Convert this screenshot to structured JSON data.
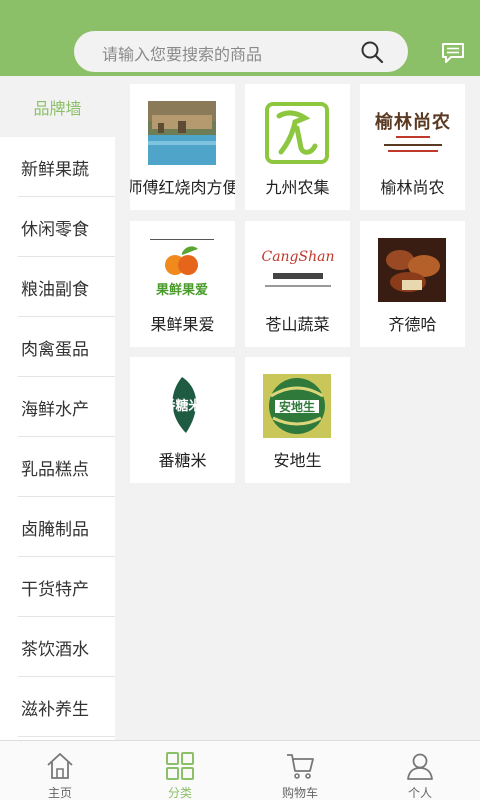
{
  "search": {
    "placeholder": "请输入您要搜索的商品"
  },
  "sidebar": {
    "header": "品牌墙",
    "items": [
      {
        "label": "新鲜果蔬"
      },
      {
        "label": "休闲零食"
      },
      {
        "label": "粮油副食"
      },
      {
        "label": "肉禽蛋品"
      },
      {
        "label": "海鲜水产"
      },
      {
        "label": "乳品糕点"
      },
      {
        "label": "卤腌制品"
      },
      {
        "label": "干货特产"
      },
      {
        "label": "茶饮酒水"
      },
      {
        "label": "滋补养生"
      }
    ]
  },
  "brands": [
    {
      "name": "师傅红烧肉方便",
      "logo_text": ""
    },
    {
      "name": "九州农集",
      "logo_text": ""
    },
    {
      "name": "榆林尚农",
      "logo_text": "榆林尚农"
    },
    {
      "name": "果鲜果爱",
      "logo_text": "果鲜果爱"
    },
    {
      "name": "苍山蔬菜",
      "logo_text": "CangShan"
    },
    {
      "name": "齐德哈",
      "logo_text": ""
    },
    {
      "name": "番糖米",
      "logo_text": "番糖米"
    },
    {
      "name": "安地生",
      "logo_text": "安地生"
    }
  ],
  "tabs": [
    {
      "label": "主页",
      "icon": "home-icon"
    },
    {
      "label": "分类",
      "icon": "category-icon"
    },
    {
      "label": "购物车",
      "icon": "cart-icon"
    },
    {
      "label": "个人",
      "icon": "person-icon"
    }
  ],
  "colors": {
    "accent": "#8cc068",
    "background": "#f2f2f2"
  }
}
